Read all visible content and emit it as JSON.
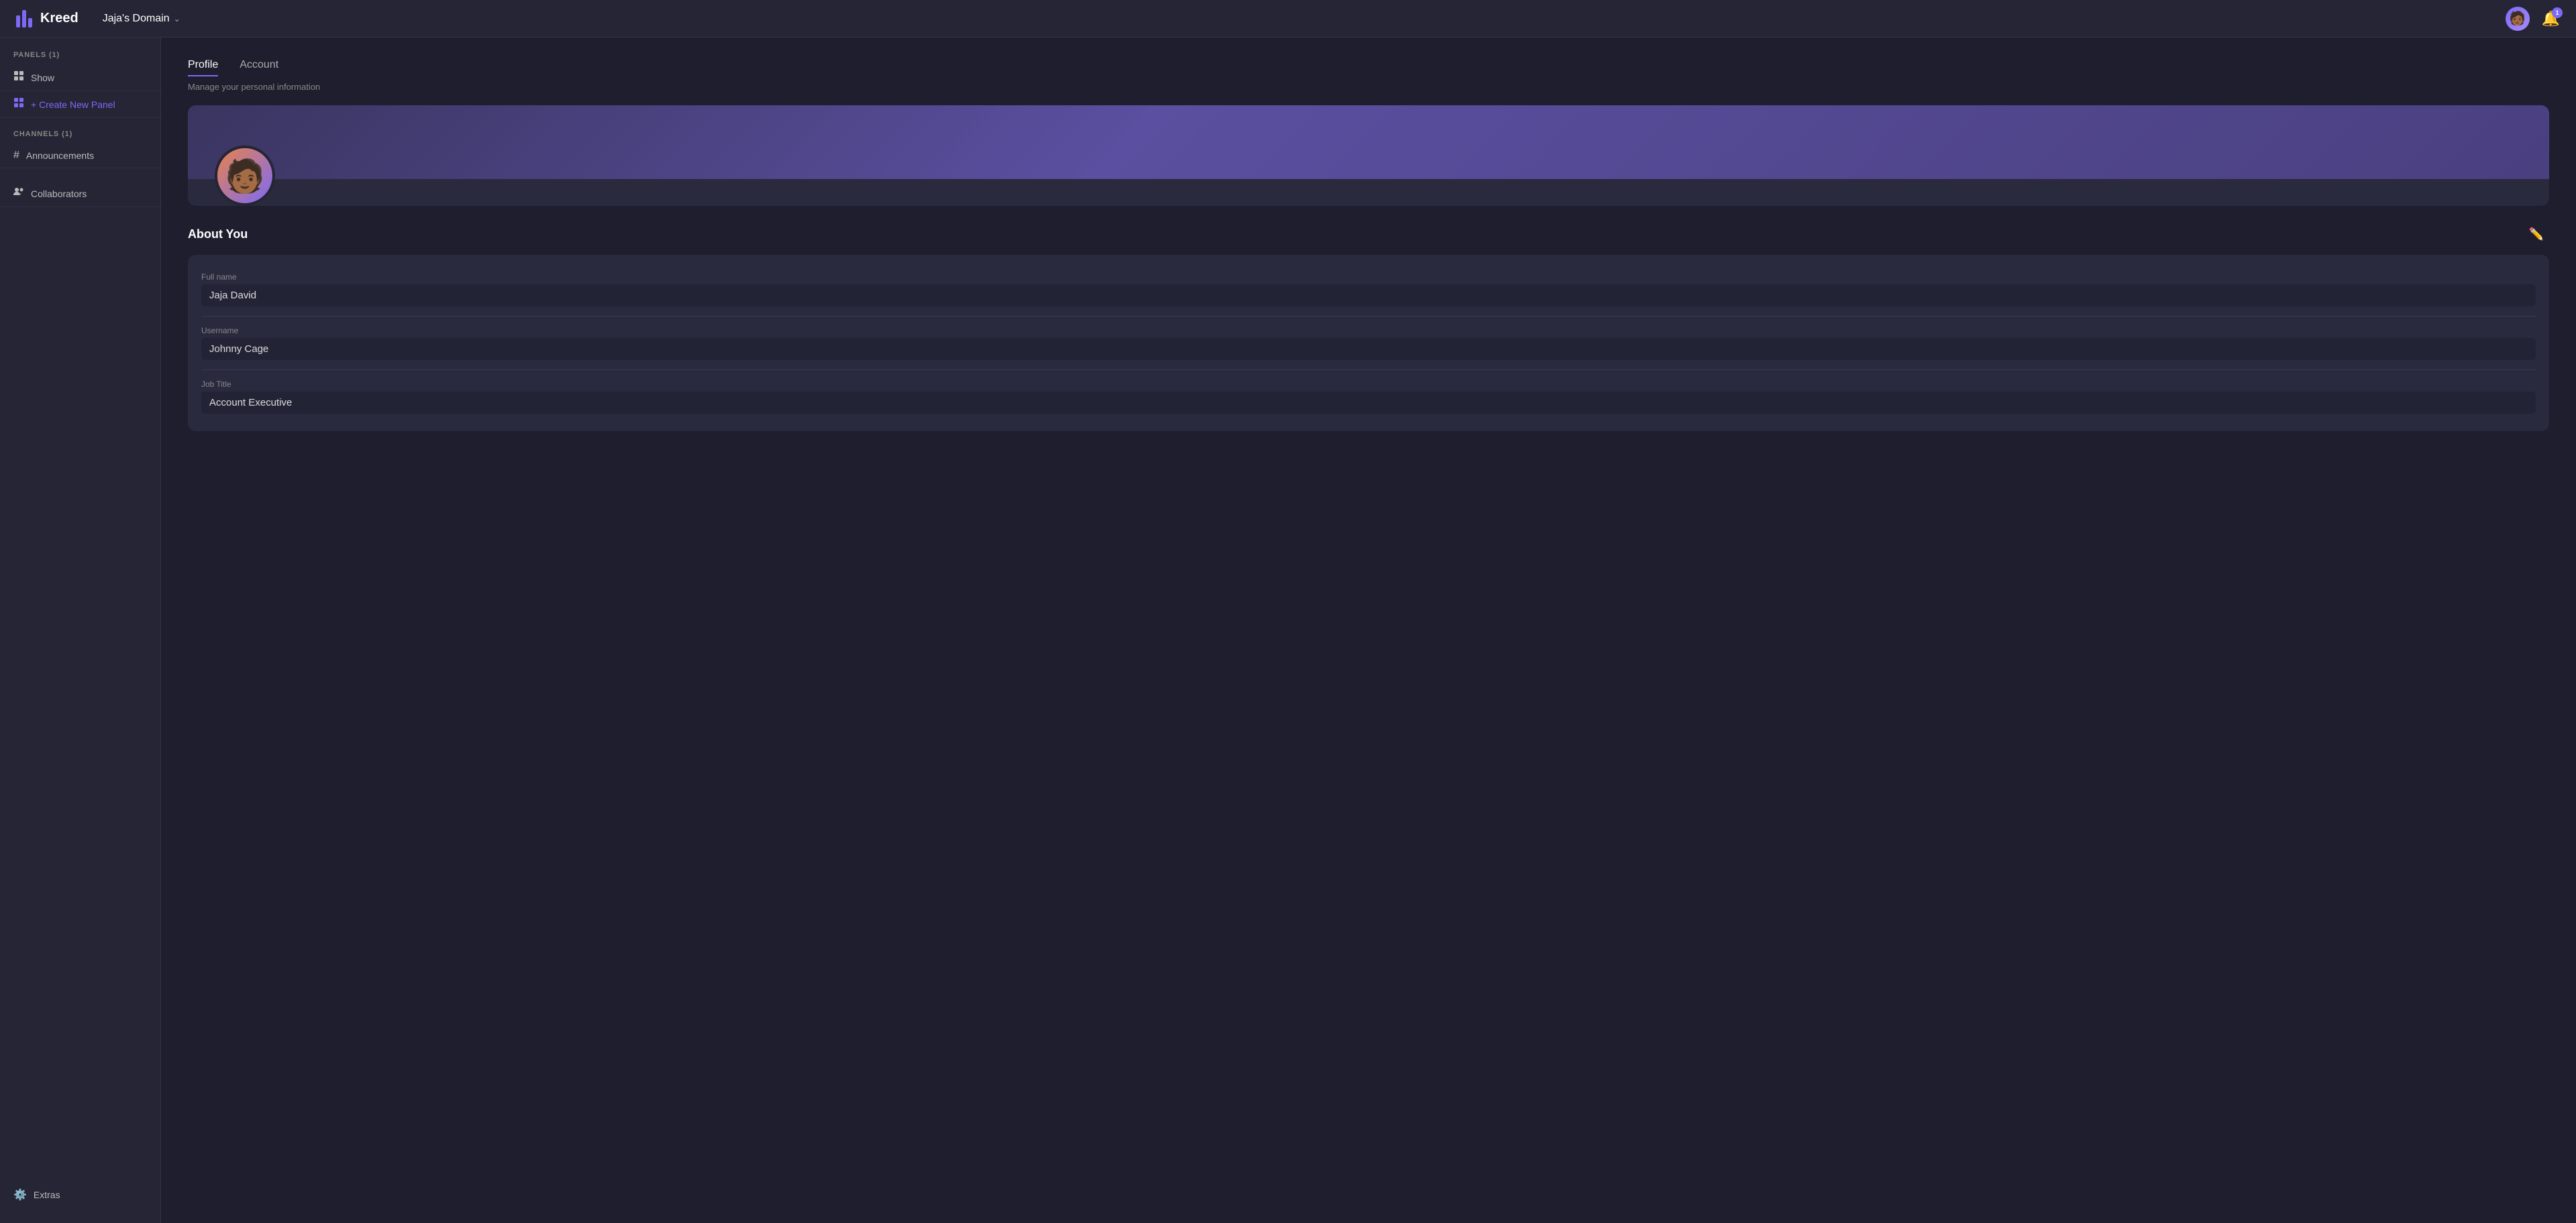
{
  "app": {
    "logo_text": "Kreed",
    "domain": "Jaja's Domain"
  },
  "topbar": {
    "domain_label": "Jaja's Domain",
    "notif_count": "1"
  },
  "sidebar": {
    "panels_label": "PANELS (1)",
    "show_label": "Show",
    "create_label": "+ Create New Panel",
    "channels_label": "CHANNELS (1)",
    "announcements_label": "Announcements",
    "collaborators_label": "Collaborators",
    "extras_label": "Extras"
  },
  "profile": {
    "tab_profile": "Profile",
    "tab_account": "Account",
    "subtitle": "Manage your personal information",
    "about_title": "About You",
    "full_name_label": "Full name",
    "full_name_value": "Jaja David",
    "username_label": "Username",
    "username_value": "Johnny Cage",
    "job_title_label": "Job Title",
    "job_title_value": "Account Executive"
  },
  "colors": {
    "accent": "#7c6af7",
    "bg_dark": "#1e1e2e",
    "bg_mid": "#252535",
    "bg_card": "#2a2a3e"
  }
}
